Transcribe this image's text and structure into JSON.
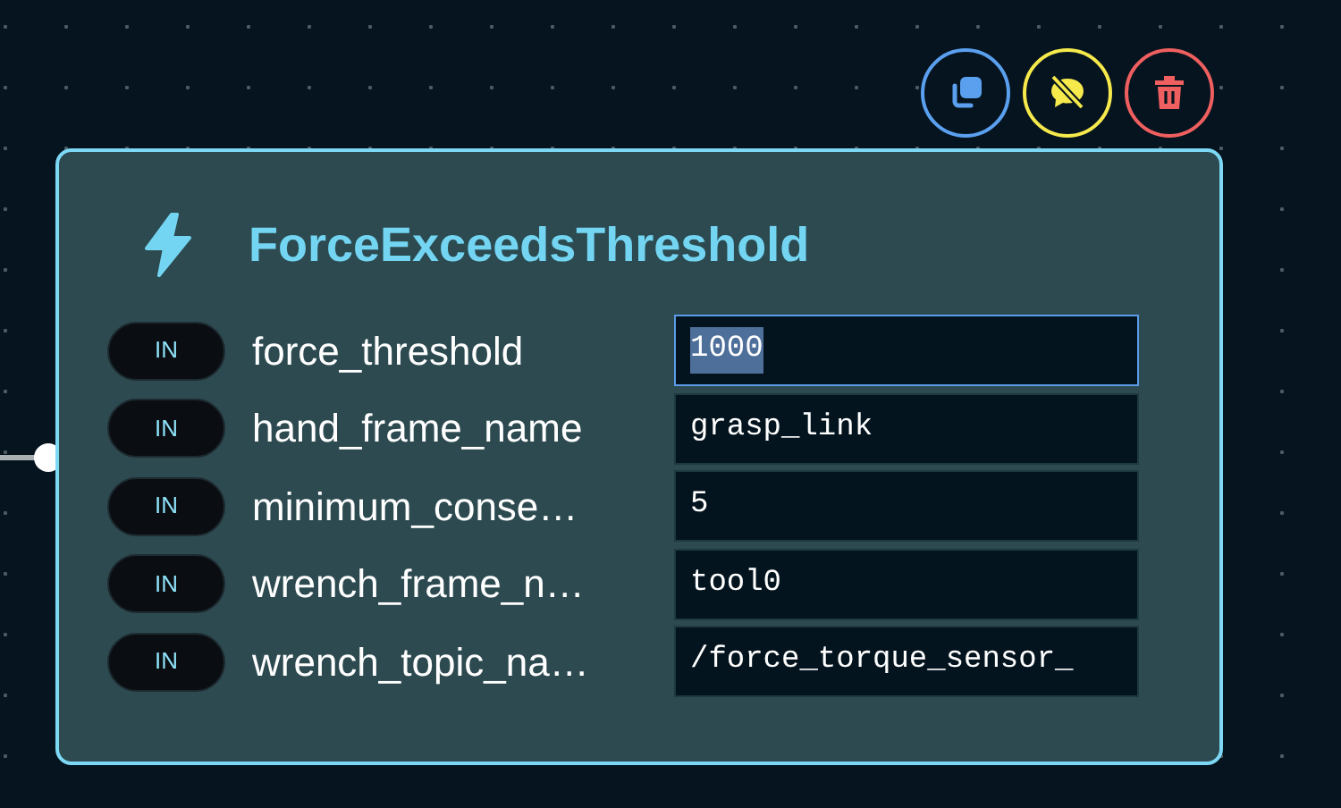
{
  "actions": [
    {
      "kind": "duplicate"
    },
    {
      "kind": "mute"
    },
    {
      "kind": "delete"
    }
  ],
  "node": {
    "title": "ForceExceedsThreshold",
    "connected": true,
    "ports": [
      {
        "direction": "IN",
        "name": "force_threshold",
        "value": "1000",
        "focused": true
      },
      {
        "direction": "IN",
        "name": "hand_frame_name",
        "value": "grasp_link",
        "focused": false
      },
      {
        "direction": "IN",
        "name": "minimum_conse…",
        "value": "5",
        "focused": false
      },
      {
        "direction": "IN",
        "name": "wrench_frame_n…",
        "value": "tool0",
        "focused": false
      },
      {
        "direction": "IN",
        "name": "wrench_topic_na…",
        "value": "/force_torque_sensor_",
        "focused": false
      }
    ]
  }
}
